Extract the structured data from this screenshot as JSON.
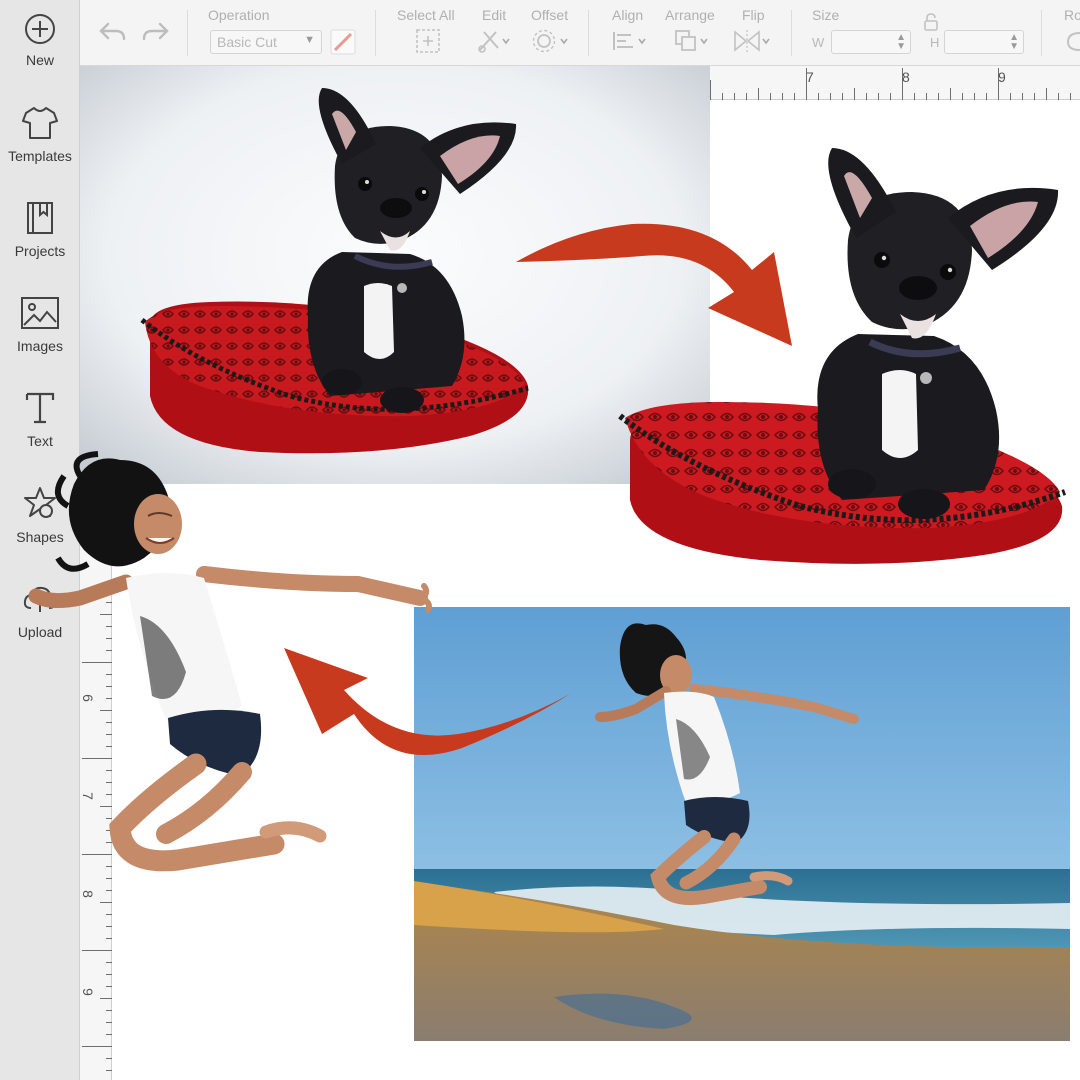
{
  "sidebar": {
    "items": [
      {
        "label": "New",
        "icon": "plus-circle-icon"
      },
      {
        "label": "Templates",
        "icon": "tshirt-icon"
      },
      {
        "label": "Projects",
        "icon": "bookmark-book-icon"
      },
      {
        "label": "Images",
        "icon": "image-icon"
      },
      {
        "label": "Text",
        "icon": "text-t-icon"
      },
      {
        "label": "Shapes",
        "icon": "shapes-icon"
      },
      {
        "label": "Upload",
        "icon": "cloud-upload-icon"
      }
    ]
  },
  "toolbar": {
    "operation_label": "Operation",
    "operation_value": "Basic Cut",
    "select_all_label": "Select All",
    "edit_label": "Edit",
    "offset_label": "Offset",
    "align_label": "Align",
    "arrange_label": "Arrange",
    "flip_label": "Flip",
    "size_label": "Size",
    "width_letter": "W",
    "height_letter": "H",
    "rotate_label": "Ro"
  },
  "ruler": {
    "top_numbers": [
      "7",
      "8",
      "9"
    ],
    "left_numbers": [
      "6",
      "7",
      "8",
      "9"
    ]
  },
  "colors": {
    "arrow": "#c83a1e",
    "sky": "#6fa7d6",
    "pillow": "#c4141a",
    "dog": "#1b1b1f"
  }
}
